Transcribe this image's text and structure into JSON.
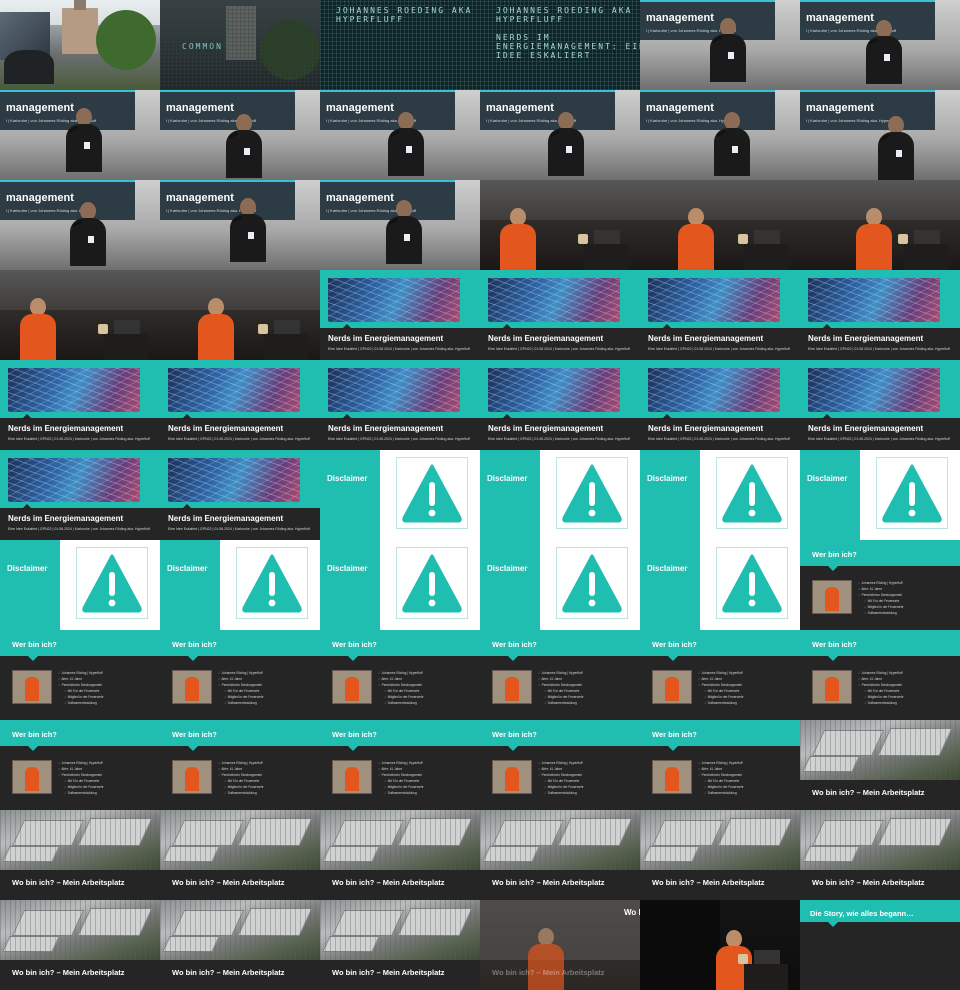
{
  "contact_sheet": {
    "columns": 6,
    "rows": 11
  },
  "slides": {
    "title": {
      "title": "Nerds im Energiemanagement",
      "subtitle": "Eine Idee Eskaliert | GPN22 | 01.06.2024 | Karlsruhe | von Johannes Röding aka. Hyperfluff"
    },
    "disclaimer": {
      "label": "Disclaimer"
    },
    "wer_bin_ich": {
      "title": "Wer bin ich?",
      "items": [
        "Johannes Röding | Hyperfluff",
        "Alter: 41 Jahre",
        "Persönliches Sendungsmerk",
        "Mit 9 in der Feuerwehr",
        "Mitglied in der Feuerwehr",
        "Softwareentwicklung"
      ]
    },
    "arbeitsplatz": {
      "title": "Wo bin ich? – Mein Arbeitsplatz"
    },
    "story": {
      "title": "Die Story, wie alles begann…"
    }
  },
  "screen_text": {
    "stage_title": "management",
    "stage_subtitle": "l | Karlsruhe | von Johannes Röding aka. Hyperfluff",
    "mono_left_top": "JOHANNES ROEDING AKA\nHYPERFLUFF",
    "mono_left_bottom": "COMMON",
    "mono_right": "JOHANNES ROEDING AKA\nHYPERFLUFF\n\nNERDS IM\nENERGIEMANAGEMENT: EINE\nIDEE ESKALIERT",
    "dark_top_caption": "Eine Idee Eskaliert | GPN22 | 01.06.2024",
    "wo_fragment": "Wo bi"
  },
  "colors": {
    "teal": "#20bdb1",
    "dark_bar": "#252525",
    "orange": "#e3561e"
  },
  "icons": {
    "warning": "warning-triangle-icon"
  }
}
